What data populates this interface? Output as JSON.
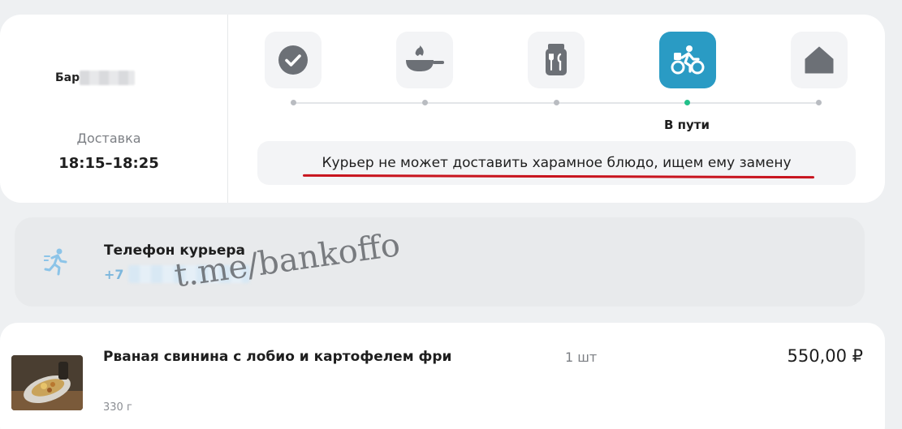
{
  "order": {
    "store_name": "Бар",
    "delivery_label": "Доставка",
    "delivery_time": "18:15–18:25",
    "steps": [
      {
        "icon": "check-icon",
        "active": false
      },
      {
        "icon": "frying-pan-icon",
        "active": false
      },
      {
        "icon": "package-icon",
        "active": false
      },
      {
        "icon": "bike-courier-icon",
        "active": true
      },
      {
        "icon": "home-icon",
        "active": false
      }
    ],
    "current_step_label": "В пути",
    "notice": "Курьер не может доставить харамное блюдо, ищем ему замену",
    "colors": {
      "active_step": "#2a9bc4",
      "active_dot": "#22c08a",
      "underline": "#c8141e"
    }
  },
  "courier": {
    "title": "Телефон курьера",
    "phone_prefix": "+7",
    "icon": "runner-icon"
  },
  "watermark": "t.me/bankoffo",
  "item": {
    "name": "Рваная свинина с лобио и картофелем фри",
    "quantity": "1 шт",
    "price": "550,00 ₽",
    "weight": "330 г"
  }
}
